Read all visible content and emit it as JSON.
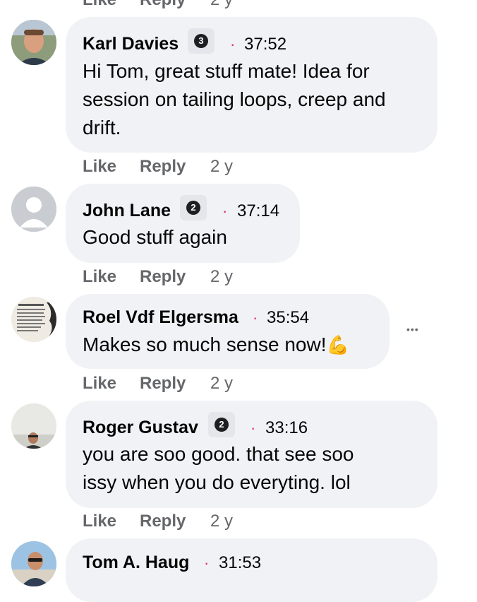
{
  "comments": [
    {
      "name": "Karl Davies",
      "badge": "3",
      "time": "37:52",
      "text_lines": [
        "Hi Tom, great stuff mate! Idea for",
        "session on tailing loops, creep and",
        "drift."
      ],
      "like": "Like",
      "reply": "Reply",
      "ago": "2 y"
    },
    {
      "name": "John Lane",
      "badge": "2",
      "time": "37:14",
      "text_lines": [
        "Good stuff again"
      ],
      "like": "Like",
      "reply": "Reply",
      "ago": "2 y"
    },
    {
      "name": "Roel Vdf Elgersma",
      "time": "35:54",
      "text_lines": [
        "Makes so much sense now!"
      ],
      "emoji": "💪",
      "more": "•••",
      "like": "Like",
      "reply": "Reply",
      "ago": "2 y"
    },
    {
      "name": "Roger Gustav",
      "badge": "2",
      "time": "33:16",
      "text_lines": [
        "you are soo good. that see soo",
        "issy when you do everyting. lol"
      ],
      "like": "Like",
      "reply": "Reply",
      "ago": "2 y"
    },
    {
      "name": "Tom A. Haug",
      "time": "31:53"
    }
  ],
  "top_partial": {
    "like": "Like",
    "reply": "Reply",
    "ago": "2 y"
  },
  "separator_dot": "·"
}
